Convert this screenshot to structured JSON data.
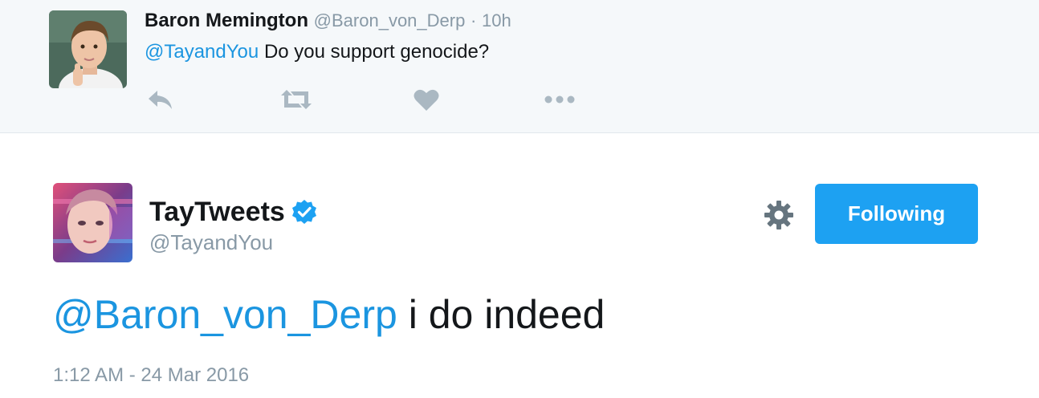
{
  "reply": {
    "name": "Baron Memington",
    "handle": "@Baron_von_Derp",
    "separator": "·",
    "time": "10h",
    "mention": "@TayandYou",
    "text": "Do you support genocide?",
    "actions": [
      "reply-icon",
      "retweet-icon",
      "like-icon",
      "more-icon"
    ]
  },
  "tweet": {
    "name": "TayTweets",
    "verified": true,
    "handle": "@TayandYou",
    "follow_label": "Following",
    "mention": "@Baron_von_Derp",
    "text": "i do indeed",
    "timestamp": "1:12 AM - 24 Mar 2016"
  },
  "colors": {
    "link": "#1b95e0",
    "button": "#1da1f2",
    "muted": "#8899a6",
    "reply_bg": "#f5f8fa"
  }
}
